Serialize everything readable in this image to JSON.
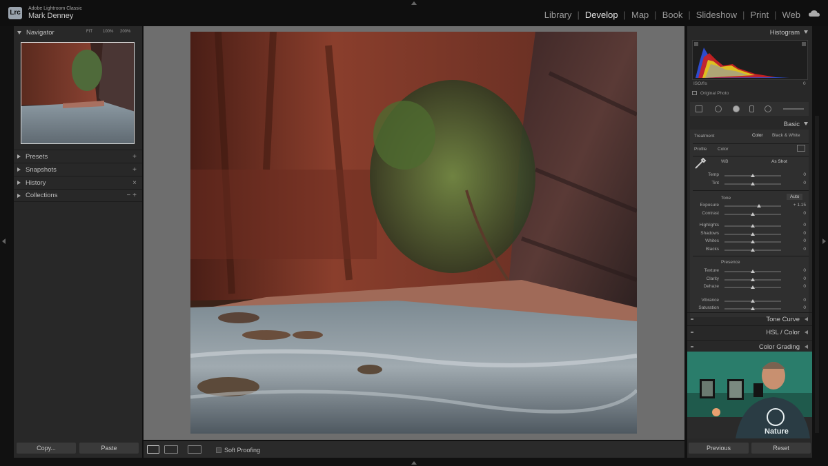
{
  "app": {
    "logo_text": "Lrc",
    "product": "Adobe Lightroom Classic",
    "user": "Mark Denney"
  },
  "modules": [
    {
      "label": "Library",
      "active": false
    },
    {
      "label": "Develop",
      "active": true
    },
    {
      "label": "Map",
      "active": false
    },
    {
      "label": "Book",
      "active": false
    },
    {
      "label": "Slideshow",
      "active": false
    },
    {
      "label": "Print",
      "active": false
    },
    {
      "label": "Web",
      "active": false
    }
  ],
  "left_panel": {
    "navigator": {
      "title": "Navigator",
      "zoom": [
        "FIT",
        "100%",
        "200%"
      ]
    },
    "sections": [
      {
        "label": "Presets",
        "action": "+"
      },
      {
        "label": "Snapshots",
        "action": "+"
      },
      {
        "label": "History",
        "action": "×"
      },
      {
        "label": "Collections",
        "action": "− +"
      }
    ],
    "copy_label": "Copy...",
    "paste_label": "Paste"
  },
  "toolbar": {
    "soft_proofing_label": "Soft Proofing"
  },
  "right_panel": {
    "histogram": {
      "title": "Histogram",
      "info": "ISO/f/s",
      "value": "0",
      "original_photo_label": "Original Photo"
    },
    "basic": {
      "title": "Basic",
      "treatment_label": "Treatment",
      "treatment_options": [
        "Color",
        "Black & White"
      ],
      "profile_label": "Profile",
      "profile_value": "Color",
      "wb_label": "WB",
      "wb_value": "As Shot",
      "wb_sliders": [
        {
          "label": "Temp",
          "value": "0",
          "pos": 0.5
        },
        {
          "label": "Tint",
          "value": "0",
          "pos": 0.5
        }
      ],
      "tone_label": "Tone",
      "auto_label": "Auto",
      "tone_sliders": [
        {
          "label": "Exposure",
          "value": "+ 1.15",
          "pos": 0.61
        },
        {
          "label": "Contrast",
          "value": "0",
          "pos": 0.5
        },
        {
          "label": "Highlights",
          "value": "0",
          "pos": 0.5
        },
        {
          "label": "Shadows",
          "value": "0",
          "pos": 0.5
        },
        {
          "label": "Whites",
          "value": "0",
          "pos": 0.5
        },
        {
          "label": "Blacks",
          "value": "0",
          "pos": 0.5
        }
      ],
      "presence_label": "Presence",
      "presence_sliders": [
        {
          "label": "Texture",
          "value": "0",
          "pos": 0.5
        },
        {
          "label": "Clarity",
          "value": "0",
          "pos": 0.5
        },
        {
          "label": "Dehaze",
          "value": "0",
          "pos": 0.5
        },
        {
          "label": "Vibrance",
          "value": "0",
          "pos": 0.5
        },
        {
          "label": "Saturation",
          "value": "0",
          "pos": 0.5
        }
      ]
    },
    "collapsed_panels": [
      "Tone Curve",
      "HSL / Color",
      "Color Grading"
    ],
    "previous_label": "Previous",
    "reset_label": "Reset"
  },
  "colors": {
    "accent_active": "#e8e8e8",
    "panel_bg": "#282828",
    "center_bg": "#6e6e6e"
  }
}
